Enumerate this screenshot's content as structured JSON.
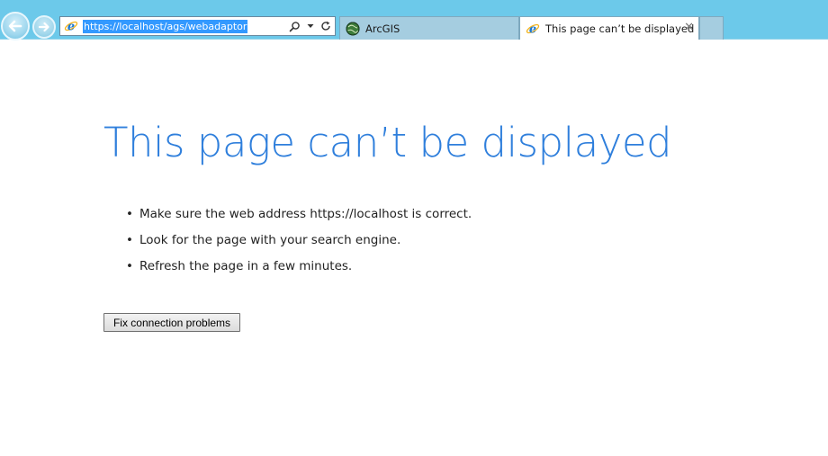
{
  "browser": {
    "address_bar": {
      "url": "https://localhost/ags/webadaptor"
    },
    "tabs": [
      {
        "label": "ArcGIS",
        "icon": "arcgis-globe-icon",
        "active": false
      },
      {
        "label": "This page can’t be displayed",
        "icon": "ie-icon",
        "active": true,
        "close_glyph": "✕"
      }
    ]
  },
  "page": {
    "title": "This page can’t be displayed",
    "tips": [
      "Make sure the web address https://localhost is correct.",
      "Look for the page with your search engine.",
      "Refresh the page in a few minutes."
    ],
    "bullet": "•",
    "fix_button_label": "Fix connection problems"
  },
  "colors": {
    "chrome_bg": "#6cc9ea",
    "title_blue": "#2f7fdc",
    "url_selection": "#3399ff"
  }
}
